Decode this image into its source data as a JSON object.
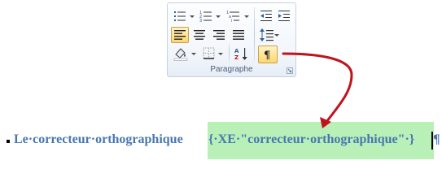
{
  "ribbon": {
    "group_label": "Paragraphe",
    "show_marks_glyph": "¶",
    "sort_label": "AZ",
    "active_tools": [
      "align-left",
      "show-formatting-marks"
    ],
    "tools": [
      "bullets-icon",
      "numbering-icon",
      "multilevel-list-icon",
      "decrease-indent-icon",
      "increase-indent-icon",
      "align-left-icon",
      "align-center-icon",
      "align-right-icon",
      "justify-icon",
      "line-spacing-icon",
      "shading-icon",
      "borders-icon",
      "sort-icon",
      "show-marks-icon"
    ]
  },
  "document": {
    "text": "Le·correcteur·orthographique",
    "field_code": "{·XE·\"correcteur·orthographique\"·}",
    "paragraph_mark": "¶"
  },
  "colors": {
    "arrow": "#c0141c",
    "field_highlight": "#b9f0b8",
    "text": "#4877b0",
    "active_button": "#ffd66e"
  }
}
